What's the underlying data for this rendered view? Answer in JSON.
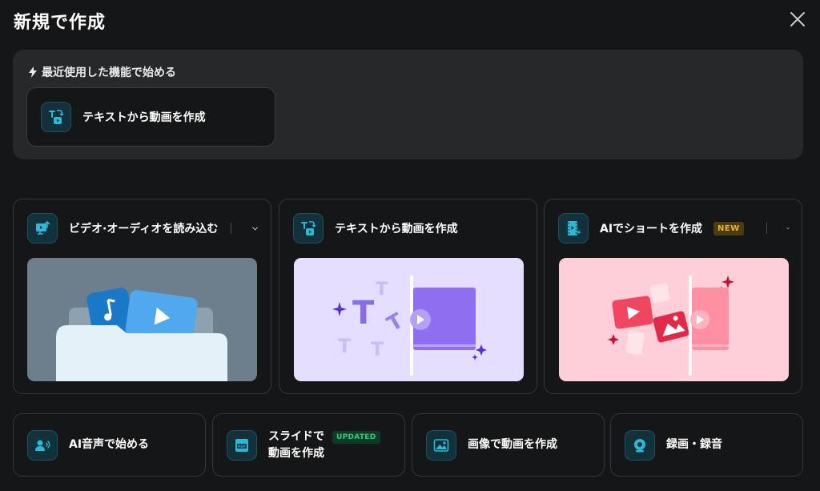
{
  "dialog": {
    "title": "新規で作成"
  },
  "recent": {
    "heading": "最近使用した機能で始める",
    "item_label": "テキストから動画を作成"
  },
  "cards": [
    {
      "label": "ビデオ·オーディオを読み込む",
      "icon": "import-media-icon"
    },
    {
      "label": "テキストから動画を作成",
      "icon": "text-to-video-icon"
    },
    {
      "label": "AIでショートを作成",
      "icon": "ai-shorts-icon",
      "badge": "NEW"
    }
  ],
  "shortcuts": [
    {
      "label": "AI音声で始める",
      "icon": "ai-voice-icon"
    },
    {
      "label_line1": "スライドで",
      "label_line2": "動画を作成",
      "icon": "pdf-slide-icon",
      "badge": "UPDATED"
    },
    {
      "label": "画像で動画を作成",
      "icon": "image-to-video-icon"
    },
    {
      "label": "録画・録音",
      "icon": "webcam-record-icon"
    }
  ],
  "colors": {
    "accent": "#2fb7d6",
    "background": "#151617",
    "panel": "#26282a",
    "new_badge": "#f2b21d",
    "updated_badge": "#2fcf7d"
  }
}
